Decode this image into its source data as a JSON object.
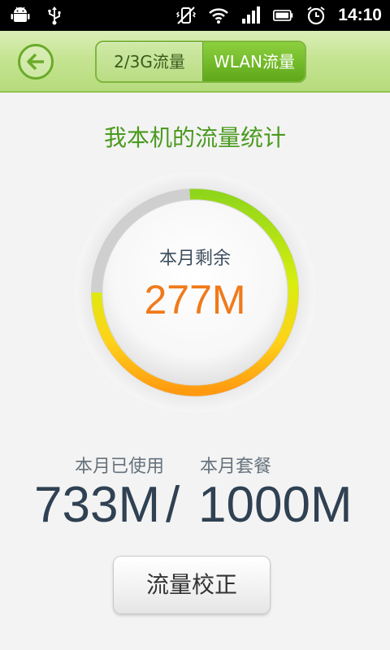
{
  "status_bar": {
    "time": "14:10",
    "left_icons": [
      "android-icon",
      "usb-icon"
    ],
    "right_icons": [
      "vibrate-off-icon",
      "wifi-icon",
      "signal-icon",
      "battery-icon",
      "alarm-icon"
    ]
  },
  "header": {
    "tabs": [
      {
        "label": "2/3G流量",
        "selected": false
      },
      {
        "label": "WLAN流量",
        "selected": true
      }
    ]
  },
  "main": {
    "title": "我本机的流量统计",
    "gauge": {
      "label": "本月剩余",
      "value": "277M",
      "remaining_fraction": 0.277
    },
    "used_label": "本月已使用",
    "package_label": "本月套餐",
    "used_value": "733M",
    "separator": "/",
    "package_value": "1000M",
    "calibrate_button": "流量校正"
  },
  "colors": {
    "accent_green": "#4a9a1e",
    "value_orange": "#f07a1a",
    "text_dark": "#2f4152"
  }
}
